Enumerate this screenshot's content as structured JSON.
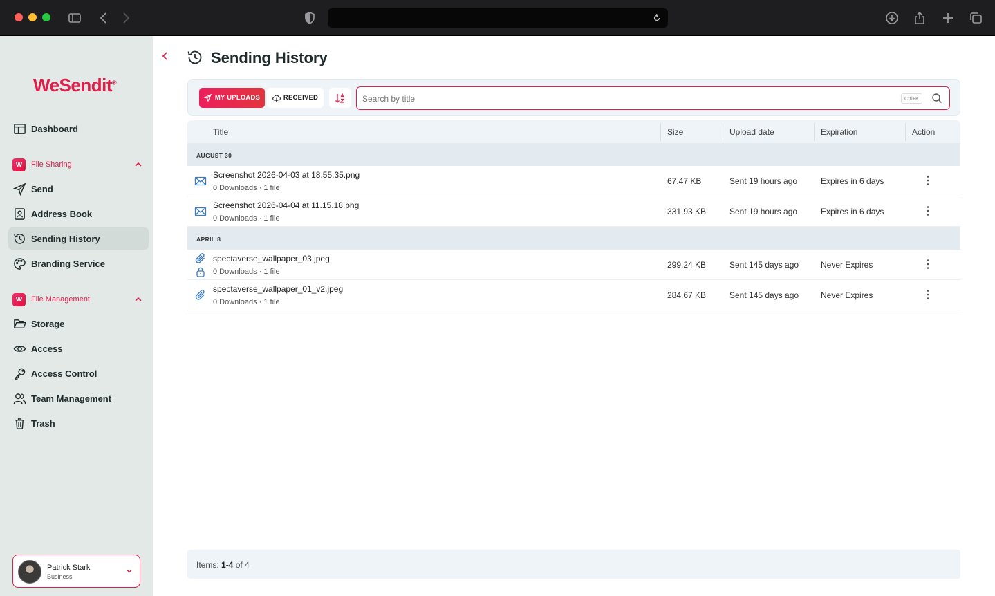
{
  "brand": {
    "name": "WeSendit",
    "mark": "®"
  },
  "sidebar": {
    "dashboard": "Dashboard",
    "file_sharing": {
      "label": "File Sharing",
      "items": [
        "Send",
        "Address Book",
        "Sending History",
        "Branding Service"
      ]
    },
    "file_management": {
      "label": "File Management",
      "items": [
        "Storage",
        "Access",
        "Access Control",
        "Team Management",
        "Trash"
      ]
    },
    "active": "Sending History"
  },
  "user": {
    "name": "Patrick Stark",
    "plan": "Business"
  },
  "page": {
    "title": "Sending History"
  },
  "filters": {
    "tabs": [
      "MY UPLOADS",
      "RECEIVED"
    ],
    "active_tab": "MY UPLOADS",
    "search_placeholder": "Search by title",
    "search_value": "",
    "shortcut": "Ctrl+K"
  },
  "table": {
    "columns": [
      "Title",
      "Size",
      "Upload date",
      "Expiration",
      "Action"
    ],
    "groups": [
      {
        "label": "AUGUST 30",
        "rows": [
          {
            "icon": "mail-icon",
            "title": "Screenshot 2026-04-03 at 18.55.35.png",
            "meta": "0 Downloads · 1 file",
            "size": "67.47 KB",
            "date": "Sent 19 hours ago",
            "expiration": "Expires in 6 days",
            "locked": false
          },
          {
            "icon": "mail-icon",
            "title": "Screenshot 2026-04-04 at 11.15.18.png",
            "meta": "0 Downloads · 1 file",
            "size": "331.93 KB",
            "date": "Sent 19 hours ago",
            "expiration": "Expires in 6 days",
            "locked": false
          }
        ]
      },
      {
        "label": "APRIL 8",
        "rows": [
          {
            "icon": "paperclip-icon",
            "title": "spectaverse_wallpaper_03.jpeg",
            "meta": "0 Downloads · 1 file",
            "size": "299.24 KB",
            "date": "Sent 145 days ago",
            "expiration": "Never Expires",
            "locked": true
          },
          {
            "icon": "paperclip-icon",
            "title": "spectaverse_wallpaper_01_v2.jpeg",
            "meta": "0 Downloads · 1 file",
            "size": "284.67 KB",
            "date": "Sent 145 days ago",
            "expiration": "Never Expires",
            "locked": false
          }
        ]
      }
    ]
  },
  "footer": {
    "prefix": "Items: ",
    "range": "1-4",
    "suffix": " of 4"
  },
  "colors": {
    "accent": "#e01e4a",
    "sidebar_bg": "#e2e9e7",
    "link_blue": "#3a7bc0"
  }
}
